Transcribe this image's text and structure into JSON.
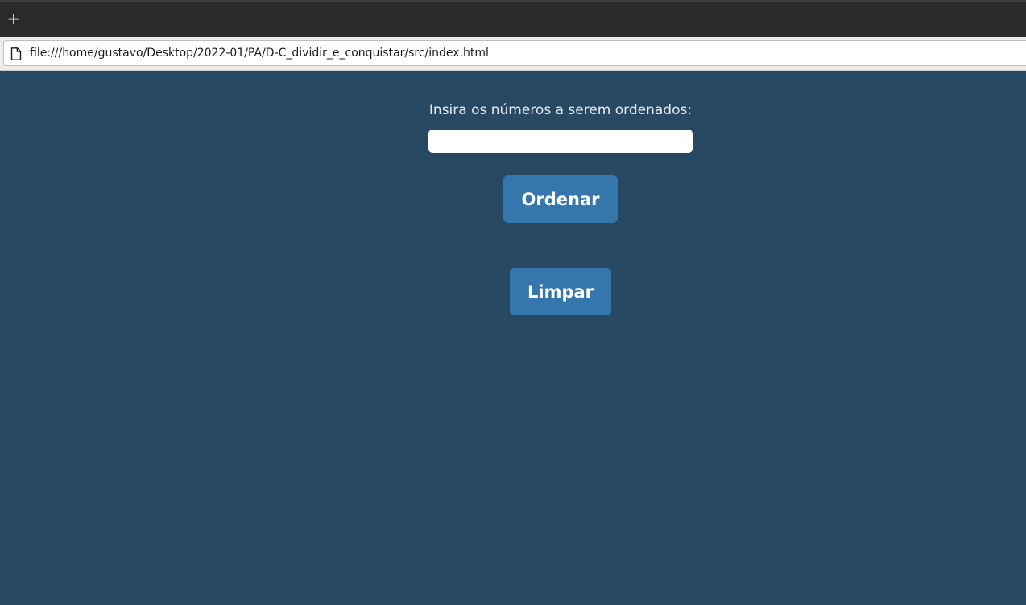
{
  "browser": {
    "new_tab_label": "+",
    "url": "file:///home/gustavo/Desktop/2022-01/PA/D-C_dividir_e_conquistar/src/index.html",
    "page_icon": "page-icon"
  },
  "main": {
    "prompt": "Insira os números a serem ordenados:",
    "input_value": "",
    "sort_button": "Ordenar",
    "clear_button": "Limpar"
  },
  "colors": {
    "background": "#274964",
    "button": "#3577ac",
    "button_text": "#ffffff"
  }
}
